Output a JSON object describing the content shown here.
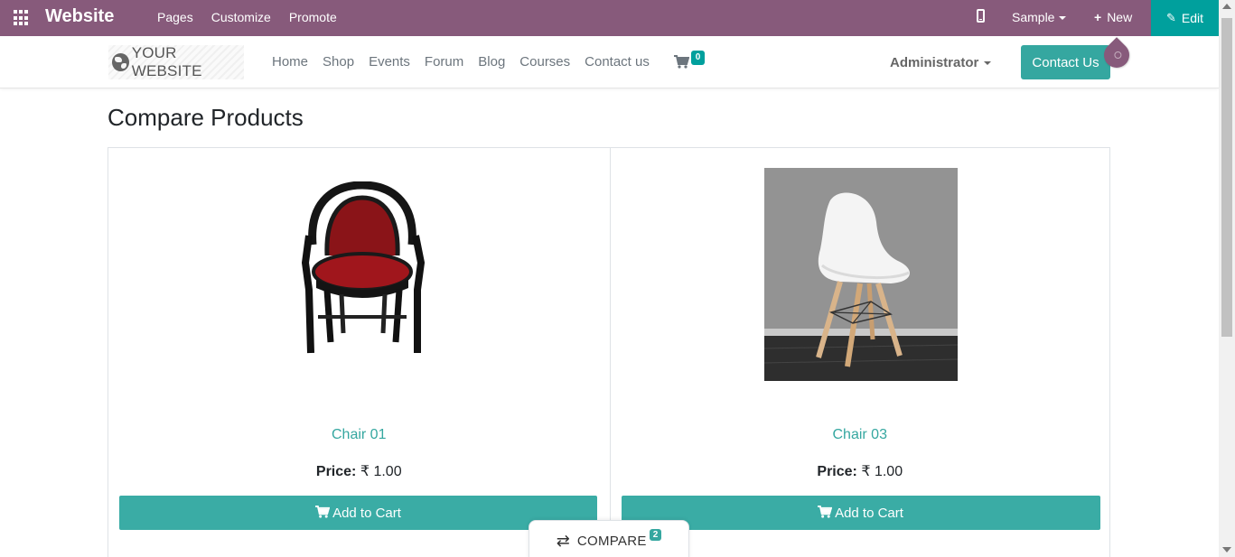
{
  "admin_bar": {
    "app_title": "Website",
    "menu": [
      "Pages",
      "Customize",
      "Promote"
    ],
    "sample_label": "Sample",
    "new_label": "New",
    "edit_label": "Edit",
    "colors": {
      "bar": "#875a7b",
      "edit": "#00a09d"
    }
  },
  "site_header": {
    "logo_text": "YOUR WEBSITE",
    "nav": [
      "Home",
      "Shop",
      "Events",
      "Forum",
      "Blog",
      "Courses",
      "Contact us"
    ],
    "cart_count": "0",
    "user": "Administrator",
    "contact_button": "Contact Us",
    "accent": "#35a7a0"
  },
  "main": {
    "title": "Compare Products",
    "products": [
      {
        "name": "Chair 01",
        "price_label": "Price:",
        "price_value": "₹ 1.00",
        "add_to_cart": "Add to Cart"
      },
      {
        "name": "Chair 03",
        "price_label": "Price:",
        "price_value": "₹ 1.00",
        "add_to_cart": "Add to Cart"
      }
    ]
  },
  "compare_tab": {
    "label": "COMPARE",
    "count": "2"
  }
}
